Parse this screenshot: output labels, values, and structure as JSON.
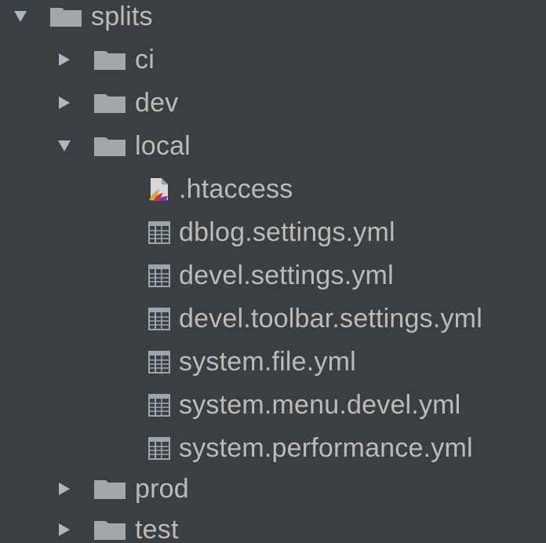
{
  "tree": {
    "root": {
      "label": "splits",
      "state": "expanded",
      "icon": "folder-icon"
    },
    "folders": [
      {
        "label": "ci",
        "state": "collapsed",
        "icon": "folder-icon"
      },
      {
        "label": "dev",
        "state": "collapsed",
        "icon": "folder-icon"
      },
      {
        "label": "local",
        "state": "expanded",
        "icon": "folder-icon"
      }
    ],
    "local_files": [
      {
        "label": ".htaccess",
        "icon": "htaccess-file-icon"
      },
      {
        "label": "dblog.settings.yml",
        "icon": "yml-file-icon"
      },
      {
        "label": "devel.settings.yml",
        "icon": "yml-file-icon"
      },
      {
        "label": "devel.toolbar.settings.yml",
        "icon": "yml-file-icon"
      },
      {
        "label": "system.file.yml",
        "icon": "yml-file-icon"
      },
      {
        "label": "system.menu.devel.yml",
        "icon": "yml-file-icon"
      },
      {
        "label": "system.performance.yml",
        "icon": "yml-file-icon"
      }
    ],
    "trailing_folders": [
      {
        "label": "prod",
        "state": "collapsed",
        "icon": "folder-icon"
      },
      {
        "label": "test",
        "state": "collapsed",
        "icon": "folder-icon"
      }
    ]
  },
  "colors": {
    "background": "#3c3f41",
    "text": "#bbbbbb",
    "arrow": "#a9b7c6",
    "folder": "#a3a7ab",
    "yml_icon": "#9aa7b0"
  }
}
